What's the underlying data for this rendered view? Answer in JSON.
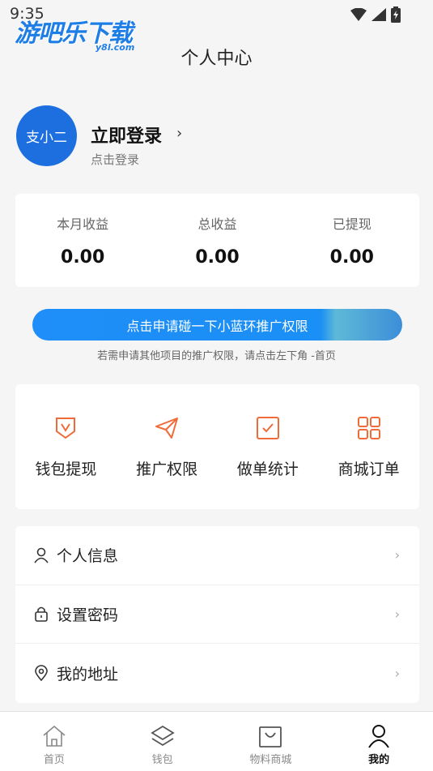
{
  "status_bar": {
    "time": "9:35"
  },
  "watermark": {
    "text": "游吧乐下载",
    "sub": "y8l.com"
  },
  "header": {
    "title": "个人中心"
  },
  "profile": {
    "avatar_text": "支小二",
    "login_title": "立即登录",
    "login_sub": "点击登录"
  },
  "earnings": [
    {
      "label": "本月收益",
      "value": "0.00"
    },
    {
      "label": "总收益",
      "value": "0.00"
    },
    {
      "label": "已提现",
      "value": "0.00"
    }
  ],
  "apply": {
    "button_label": "点击申请碰一下小蓝环推广权限",
    "note": "若需申请其他项目的推广权限，请点击左下角 -首页"
  },
  "grid": [
    {
      "label": "钱包提现",
      "icon": "shield-v-icon"
    },
    {
      "label": "推广权限",
      "icon": "paper-plane-icon"
    },
    {
      "label": "做单统计",
      "icon": "checkbox-icon"
    },
    {
      "label": "商城订单",
      "icon": "grid-icon"
    }
  ],
  "menu": [
    {
      "label": "个人信息",
      "icon": "user-icon"
    },
    {
      "label": "设置密码",
      "icon": "lock-icon"
    },
    {
      "label": "我的地址",
      "icon": "location-icon"
    }
  ],
  "tabs": [
    {
      "label": "首页",
      "icon": "home-icon"
    },
    {
      "label": "钱包",
      "icon": "layers-icon"
    },
    {
      "label": "物料商城",
      "icon": "bag-icon"
    },
    {
      "label": "我的",
      "icon": "person-icon",
      "active": true
    }
  ],
  "colors": {
    "accent": "#1f8ef8",
    "icon_orange": "#f06b3a",
    "avatar_blue": "#1d6fe0"
  }
}
